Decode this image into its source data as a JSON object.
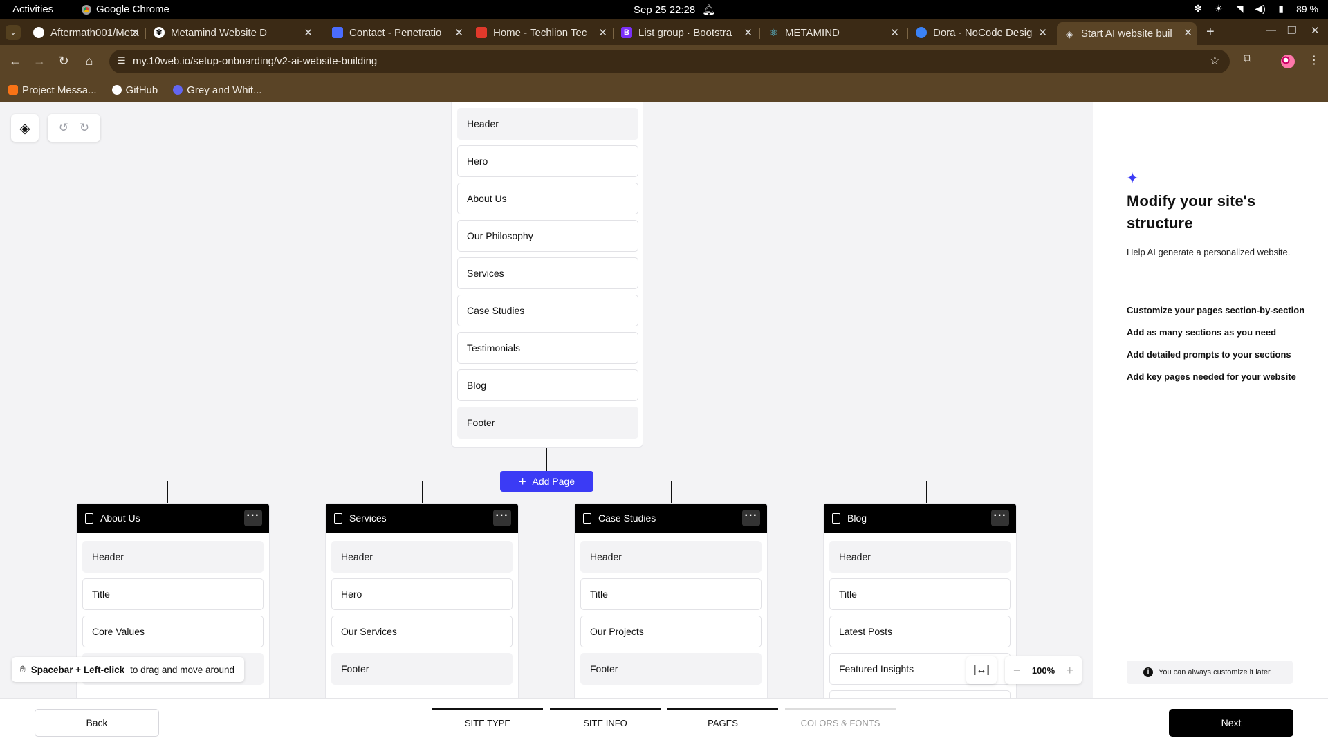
{
  "os": {
    "activities": "Activities",
    "app_name": "Google Chrome",
    "clock": "Sep 25  22:28",
    "battery": "89 %"
  },
  "browser": {
    "tabs": [
      {
        "title": "Aftermath001/Meta",
        "favicon": "github-icon",
        "color": "#ffffff"
      },
      {
        "title": "Metamind Website D",
        "favicon": "openai-icon",
        "color": "#ffffff"
      },
      {
        "title": "Contact - Penetratio",
        "favicon": "shield-icon",
        "color": "#4a6cff"
      },
      {
        "title": "Home - Techlion Tec",
        "favicon": "techlion-icon",
        "color": "#e0392b"
      },
      {
        "title": "List group · Bootstra",
        "favicon": "bootstrap-icon",
        "color": "#7b2ff7"
      },
      {
        "title": "METAMIND",
        "favicon": "react-icon",
        "color": "#61dafb"
      },
      {
        "title": "Dora - NoCode Desig",
        "favicon": "dora-icon",
        "color": "#3b82f6"
      },
      {
        "title": "Start AI website buil",
        "favicon": "10web-icon",
        "color": "#ffffff"
      }
    ],
    "url": "my.10web.io/setup-onboarding/v2-ai-website-building",
    "bookmarks": [
      {
        "label": "Project Messa...",
        "icon": "bookmark-icon"
      },
      {
        "label": "GitHub",
        "icon": "github-icon"
      },
      {
        "label": "Grey and Whit...",
        "icon": "canva-icon"
      }
    ]
  },
  "builder": {
    "home_sections": [
      "Header",
      "Hero",
      "About Us",
      "Our Philosophy",
      "Services",
      "Case Studies",
      "Testimonials",
      "Blog",
      "Footer"
    ],
    "add_page_label": "Add Page",
    "pages": [
      {
        "title": "About Us",
        "sections": [
          "Header",
          "Title",
          "Core Values",
          ""
        ]
      },
      {
        "title": "Services",
        "sections": [
          "Header",
          "Hero",
          "Our Services",
          "Footer"
        ]
      },
      {
        "title": "Case Studies",
        "sections": [
          "Header",
          "Title",
          "Our Projects",
          "Footer"
        ]
      },
      {
        "title": "Blog",
        "sections": [
          "Header",
          "Title",
          "Latest Posts",
          "Featured Insights",
          ""
        ]
      }
    ],
    "hint_bold": "Spacebar + Left-click",
    "hint_rest": "to drag and move around",
    "zoom": "100%"
  },
  "panel": {
    "title": "Modify your site's structure",
    "subtitle": "Help AI generate a personalized website.",
    "tips": [
      "Customize your pages section-by-section",
      "Add as many sections as you need",
      "Add detailed prompts to your sections",
      "Add key pages needed for your website"
    ],
    "note": "You can always customize it later."
  },
  "footer": {
    "back_label": "Back",
    "next_label": "Next",
    "steps": [
      "SITE TYPE",
      "SITE INFO",
      "PAGES",
      "COLORS & FONTS"
    ]
  },
  "colors": {
    "accent": "#3b3bf5",
    "tabstrip": "#3b2a15",
    "toolbar": "#5a4426"
  }
}
